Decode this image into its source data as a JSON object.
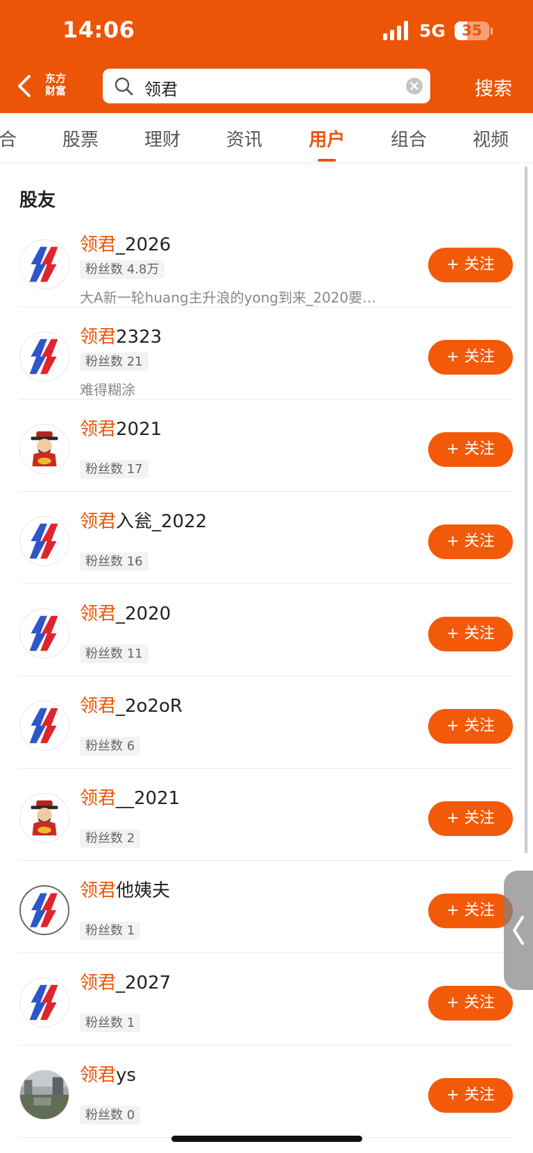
{
  "status_bar": {
    "time": "14:06",
    "network": "5G",
    "battery": "35",
    "battery_level": 0.35
  },
  "header": {
    "back_icon": "chevron-left-icon",
    "logo_text": "东方财富",
    "search_value": "领君",
    "search_icon": "search-icon",
    "clear_icon": "clear-circle-icon",
    "search_action": "搜索"
  },
  "tabs": [
    {
      "label": "合",
      "active": false
    },
    {
      "label": "股票",
      "active": false
    },
    {
      "label": "理财",
      "active": false
    },
    {
      "label": "资讯",
      "active": false
    },
    {
      "label": "用户",
      "active": true
    },
    {
      "label": "组合",
      "active": false
    },
    {
      "label": "视频",
      "active": false
    }
  ],
  "section_title": "股友",
  "follow_label": "+ 关注",
  "users": [
    {
      "highlight": "领君",
      "rest": "_2026",
      "fans": "粉丝数 4.8万",
      "bio": "大A新一轮huang主升浪的yong到来_2020要…",
      "avatar": "brand-logo-avatar"
    },
    {
      "highlight": "领君",
      "rest": "2323",
      "fans": "粉丝数 21",
      "bio": "难得糊涂",
      "avatar": "brand-logo-avatar"
    },
    {
      "highlight": "领君",
      "rest": "2021",
      "fans": "粉丝数 17",
      "bio": "",
      "avatar": "fortune-god-avatar"
    },
    {
      "highlight": "领君",
      "rest": "入瓮_2022",
      "fans": "粉丝数 16",
      "bio": "",
      "avatar": "brand-logo-avatar"
    },
    {
      "highlight": "领君",
      "rest": "_2020",
      "fans": "粉丝数 11",
      "bio": "",
      "avatar": "brand-logo-avatar"
    },
    {
      "highlight": "领君",
      "rest": "_2o2oR",
      "fans": "粉丝数 6",
      "bio": "",
      "avatar": "brand-logo-avatar"
    },
    {
      "highlight": "领君",
      "rest": "__2021",
      "fans": "粉丝数 2",
      "bio": "",
      "avatar": "fortune-god-avatar"
    },
    {
      "highlight": "领君",
      "rest": "他姨夫",
      "fans": "粉丝数 1",
      "bio": "",
      "avatar": "brand-logo-avatar"
    },
    {
      "highlight": "领君",
      "rest": "_2027",
      "fans": "粉丝数 1",
      "bio": "",
      "avatar": "brand-logo-avatar"
    },
    {
      "highlight": "领君",
      "rest": "ys",
      "fans": "粉丝数 0",
      "bio": "",
      "avatar": "photo-avatar"
    }
  ],
  "side_handle_icon": "chevron-left-icon",
  "colors": {
    "brand": "#ec5407",
    "button": "#f25a0a"
  }
}
